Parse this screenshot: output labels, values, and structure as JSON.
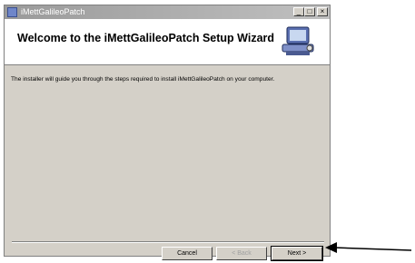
{
  "window": {
    "title": "iMettGalileoPatch",
    "controls": {
      "minimize": "_",
      "maximize": "□",
      "close": "×"
    }
  },
  "header": {
    "heading": "Welcome to the iMettGalileoPatch Setup Wizard",
    "icon": "computer-setup-icon"
  },
  "body": {
    "text": "The installer will guide you through the steps required to install iMettGalileoPatch on your computer."
  },
  "buttons": {
    "cancel": "Cancel",
    "back": "< Back",
    "next": "Next >"
  }
}
